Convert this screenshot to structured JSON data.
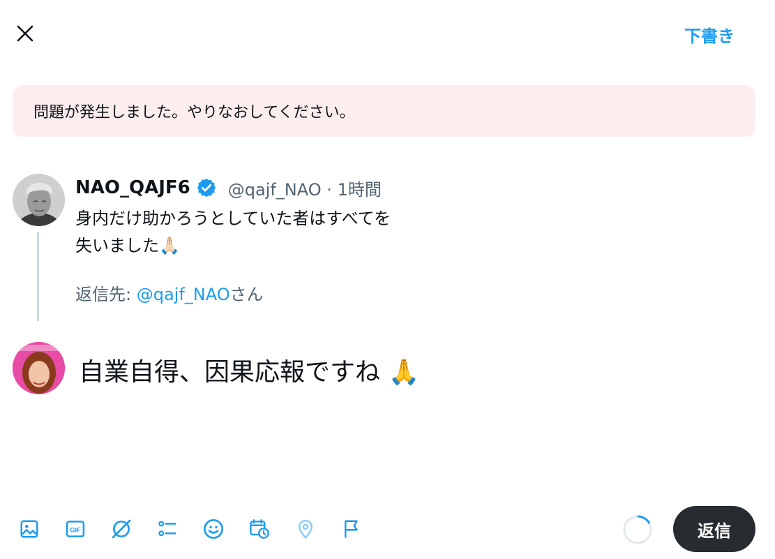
{
  "header": {
    "close_icon": "close-icon",
    "drafts_label": "下書き"
  },
  "error": {
    "message": "問題が発生しました。やりなおしてください。"
  },
  "original_post": {
    "display_name": "NAO_QAJF6",
    "verified": true,
    "handle": "@qajf_NAO",
    "separator": "·",
    "time": "1時間",
    "text_line1": "身内だけ助かろうとしていた者はすべてを",
    "text_line2": "失いました🙏🏻",
    "reply_prefix": "返信先: ",
    "reply_mention": "@qajf_NAO",
    "reply_suffix": "さん"
  },
  "compose": {
    "text": "自業自得、因果応報ですね 🙏"
  },
  "toolbar": {
    "icons": [
      "image-icon",
      "gif-icon",
      "grok-icon",
      "poll-icon",
      "emoji-icon",
      "schedule-icon",
      "location-icon",
      "flag-icon"
    ],
    "reply_button_label": "返信"
  },
  "colors": {
    "accent": "#1d9bf0",
    "error_bg": "#fdeeee",
    "button_dark": "#272c30",
    "secondary_text": "#536471"
  }
}
